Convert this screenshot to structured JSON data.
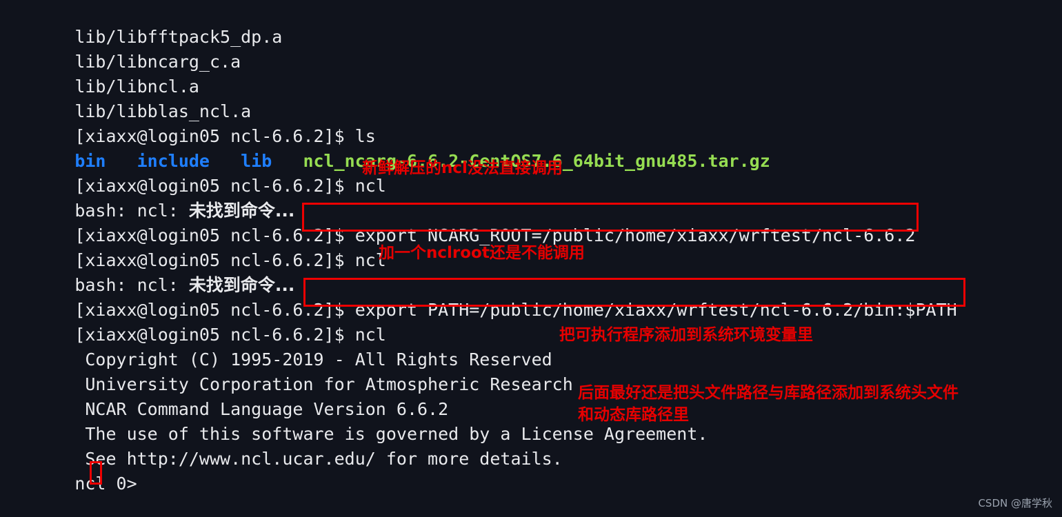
{
  "terminal": {
    "background_color": "#10131c",
    "foreground_color": "#e8e9ec",
    "dir_color": "#1f7fff",
    "archive_color": "#96dd52",
    "annotation_color": "#e60000",
    "prompt": "[xiaxx@login05 ncl-6.6.2]$ ",
    "lines": [
      {
        "id": "l1",
        "text": "lib/libfftpack5_dp.a"
      },
      {
        "id": "l2",
        "text": "lib/libncarg_c.a"
      },
      {
        "id": "l3",
        "text": "lib/libncl.a"
      },
      {
        "id": "l4",
        "text": "lib/libblas_ncl.a"
      },
      {
        "id": "l5",
        "text": "[xiaxx@login05 ncl-6.6.2]$ ls"
      },
      {
        "id": "l6a",
        "text": "bin   include   lib"
      },
      {
        "id": "l6b",
        "text": "ncl_ncarg-6.6.2-CentOS7.6_64bit_gnu485.tar.gz"
      },
      {
        "id": "l7",
        "text": "[xiaxx@login05 ncl-6.6.2]$ ncl"
      },
      {
        "id": "l8a",
        "text": "bash: ncl: "
      },
      {
        "id": "l8b",
        "text": "未找到命令..."
      },
      {
        "id": "l9",
        "text": "[xiaxx@login05 ncl-6.6.2]$ export NCARG_ROOT=/public/home/xiaxx/wrftest/ncl-6.6.2"
      },
      {
        "id": "l10",
        "text": "[xiaxx@login05 ncl-6.6.2]$ ncl"
      },
      {
        "id": "l11a",
        "text": "bash: ncl: "
      },
      {
        "id": "l11b",
        "text": "未找到命令..."
      },
      {
        "id": "l12",
        "text": "[xiaxx@login05 ncl-6.6.2]$ export PATH=/public/home/xiaxx/wrftest/ncl-6.6.2/bin:$PATH"
      },
      {
        "id": "l13",
        "text": "[xiaxx@login05 ncl-6.6.2]$ ncl"
      },
      {
        "id": "l14",
        "text": " Copyright (C) 1995-2019 - All Rights Reserved"
      },
      {
        "id": "l15",
        "text": " University Corporation for Atmospheric Research"
      },
      {
        "id": "l16",
        "text": " NCAR Command Language Version 6.6.2"
      },
      {
        "id": "l17",
        "text": " The use of this software is governed by a License Agreement."
      },
      {
        "id": "l18",
        "text": " See http://www.ncl.ucar.edu/ for more details."
      },
      {
        "id": "l19",
        "text": "ncl 0> "
      }
    ],
    "commands": {
      "ls": "ls",
      "ncl": "ncl",
      "export_ncarg_root": "export NCARG_ROOT=/public/home/xiaxx/wrftest/ncl-6.6.2",
      "export_path": "export PATH=/public/home/xiaxx/wrftest/ncl-6.6.2/bin:$PATH"
    },
    "ls_output": {
      "dirs": [
        "bin",
        "include",
        "lib"
      ],
      "archive": "ncl_ncarg-6.6.2-CentOS7.6_64bit_gnu485.tar.gz"
    },
    "errors": {
      "prefix": "bash: ncl: ",
      "message": "未找到命令..."
    },
    "banner": {
      "copyright": " Copyright (C) 1995-2019 - All Rights Reserved",
      "org": " University Corporation for Atmospheric Research",
      "version": " NCAR Command Language Version 6.6.2",
      "license": " The use of this software is governed by a License Agreement.",
      "url": " See http://www.ncl.ucar.edu/ for more details."
    },
    "ncl_prompt": "ncl 0> "
  },
  "annotations": [
    {
      "id": "a1",
      "text": "新鲜解压的ncl没法直接调用"
    },
    {
      "id": "a2",
      "text": "加一个nclroot还是不能调用"
    },
    {
      "id": "a3",
      "text": "把可执行程序添加到系统环境变量里"
    },
    {
      "id": "a4",
      "text": "后面最好还是把头文件路径与库路径添加到系统头文件和动态库路径里"
    }
  ],
  "watermark": {
    "text": "CSDN @唐学秋"
  }
}
